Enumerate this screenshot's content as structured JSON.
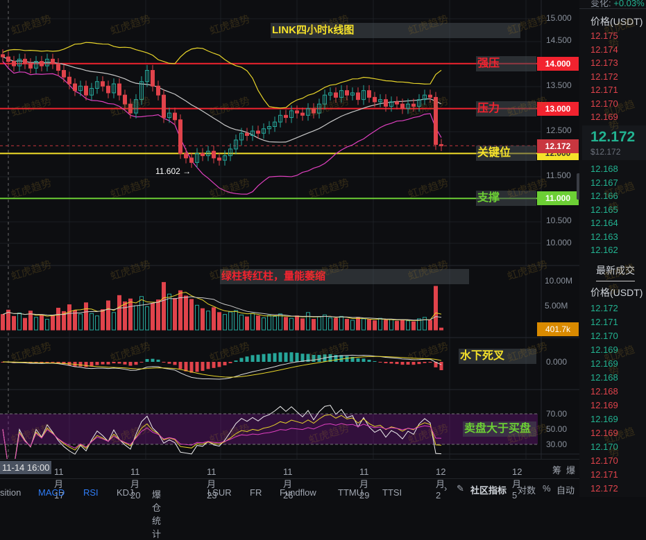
{
  "title": "LINK四小时k线图",
  "watermark": "虹虎趋势",
  "colors": {
    "up": "#26a69a",
    "down": "#e0434b",
    "strong_resistance": "#f2232f",
    "key": "#f5e12a",
    "support": "#6ccf35",
    "bb_mid": "#c9c9c9",
    "bb_up": "#e8d52a",
    "bb_low": "#e040c0",
    "vol_tag": "#d98a00",
    "accent": "#2f7cf6"
  },
  "levels": [
    {
      "label": "强压",
      "value": 14.0,
      "tag": "14.000",
      "color": "#f2232f"
    },
    {
      "label": "压力",
      "value": 13.0,
      "tag": "13.000",
      "color": "#f2232f"
    },
    {
      "label": "关键位",
      "value": 12.0,
      "tag": "12.000",
      "color": "#f5e12a"
    },
    {
      "label": "支撑",
      "value": 11.0,
      "tag": "11.000",
      "color": "#6ccf35"
    }
  ],
  "current_price_tag": "12.172",
  "low_marker": "11.602",
  "notes": {
    "volume": "绿柱转红柱，量能萎缩",
    "macd": "水下死叉",
    "rsi": "卖盘大于买盘"
  },
  "price_axis": [
    "15.000",
    "14.500",
    "13.500",
    "12.500",
    "11.500",
    "10.500",
    "10.000"
  ],
  "volume_axis": [
    "10.00M",
    "5.00M"
  ],
  "volume_tag": "401.7k",
  "macd_axis": [
    "0.000"
  ],
  "rsi_axis": [
    "70.00",
    "50.00",
    "30.00"
  ],
  "chart_data": {
    "type": "candlestick",
    "interval": "4h",
    "start": "11-14 16:00",
    "x_ticks": [
      "11月17",
      "11月20",
      "11月23",
      "11月26",
      "11月29",
      "12月2",
      "12月5"
    ],
    "ylim": [
      10.0,
      15.0
    ],
    "close": [
      14.15,
      14.05,
      13.95,
      14.1,
      14.0,
      13.9,
      14.05,
      13.95,
      14.1,
      14.0,
      13.85,
      13.7,
      13.55,
      13.4,
      13.5,
      13.3,
      13.45,
      13.6,
      13.5,
      13.35,
      13.55,
      13.3,
      13.1,
      12.9,
      13.2,
      13.6,
      13.85,
      13.5,
      13.3,
      12.8,
      12.9,
      12.75,
      12.0,
      11.9,
      11.8,
      12.0,
      11.95,
      12.05,
      11.9,
      11.85,
      11.95,
      12.1,
      12.3,
      12.45,
      12.4,
      12.5,
      12.45,
      12.55,
      12.6,
      12.7,
      12.85,
      12.8,
      12.95,
      12.9,
      12.85,
      13.0,
      12.9,
      13.1,
      13.3,
      13.35,
      13.25,
      13.4,
      13.3,
      13.35,
      13.2,
      13.4,
      13.25,
      13.15,
      13.2,
      13.05,
      13.15,
      13.1,
      13.0,
      13.1,
      13.05,
      13.2,
      13.3,
      13.25,
      12.2,
      12.172
    ],
    "volume_m": [
      3.2,
      4.1,
      2.8,
      3.5,
      2.4,
      3.9,
      2.6,
      3.1,
      2.2,
      3.0,
      4.5,
      3.8,
      5.2,
      4.0,
      3.3,
      5.6,
      3.4,
      2.9,
      4.2,
      6.0,
      3.6,
      7.1,
      5.8,
      6.4,
      5.0,
      6.9,
      4.8,
      5.5,
      6.2,
      9.8,
      7.4,
      6.5,
      8.1,
      7.0,
      6.3,
      5.1,
      4.4,
      3.9,
      4.6,
      3.6,
      3.2,
      3.7,
      4.0,
      3.1,
      2.7,
      3.4,
      2.9,
      2.5,
      3.0,
      2.8,
      3.3,
      2.6,
      2.4,
      2.9,
      2.3,
      3.6,
      2.2,
      2.7,
      3.1,
      2.5,
      2.4,
      2.8,
      2.2,
      2.0,
      2.6,
      2.3,
      2.1,
      1.9,
      2.4,
      2.0,
      2.2,
      1.8,
      2.1,
      1.9,
      1.7,
      2.3,
      2.6,
      2.0,
      9.0,
      0.4017
    ],
    "indicators": [
      "BOLL",
      "MACD",
      "RSI"
    ]
  },
  "date_axis": {
    "cursor_label": "11-14 16:00",
    "right_icons": [
      "筹",
      "爆"
    ]
  },
  "toolbar": {
    "items": [
      {
        "label": "sition",
        "active": false
      },
      {
        "label": "MACD",
        "active": true
      },
      {
        "label": "RSI",
        "active": true
      },
      {
        "label": "KDJ",
        "active": false
      },
      {
        "label": "爆仓统计",
        "active": false
      },
      {
        "label": "LSUR",
        "active": false
      },
      {
        "label": "FR",
        "active": false
      },
      {
        "label": "Fundflow",
        "active": false
      },
      {
        "label": "TTMU",
        "active": false
      },
      {
        "label": "TTSI",
        "active": false
      }
    ],
    "more": "›",
    "community": "社区指标",
    "log": "对数",
    "percent": "%",
    "auto": "自动"
  },
  "panel": {
    "change_label": "变化:",
    "change_value": "+0.03%",
    "header": "价格(USDT)",
    "asks": [
      "12.175",
      "12.174",
      "12.173",
      "12.172",
      "12.171",
      "12.170",
      "12.169"
    ],
    "last": "12.172",
    "last_usd": "$12.172",
    "bids": [
      "12.168",
      "12.167",
      "12.166",
      "12.165",
      "12.164",
      "12.163",
      "12.162"
    ],
    "trades_title": "最新成交",
    "trades_header": "价格(USDT)",
    "trades": [
      {
        "p": "12.172",
        "s": "buy"
      },
      {
        "p": "12.171",
        "s": "buy"
      },
      {
        "p": "12.170",
        "s": "buy"
      },
      {
        "p": "12.169",
        "s": "buy"
      },
      {
        "p": "12.169",
        "s": "buy"
      },
      {
        "p": "12.168",
        "s": "buy"
      },
      {
        "p": "12.168",
        "s": "sell"
      },
      {
        "p": "12.169",
        "s": "sell"
      },
      {
        "p": "12.169",
        "s": "buy"
      },
      {
        "p": "12.169",
        "s": "sell"
      },
      {
        "p": "12.170",
        "s": "buy"
      },
      {
        "p": "12.170",
        "s": "sell"
      },
      {
        "p": "12.171",
        "s": "sell"
      },
      {
        "p": "12.172",
        "s": "sell"
      }
    ]
  }
}
